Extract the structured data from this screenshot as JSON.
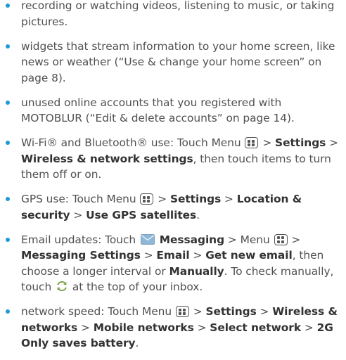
{
  "colors": {
    "bullet": "#1e9ad6",
    "text": "#505050",
    "bold": "#333333"
  },
  "items": [
    {
      "t": "recording or watching videos, listening to music, or taking pictures."
    },
    {
      "t": "widgets that stream information to your home screen, like news or weather (“Use & change your home screen” on page 8)."
    },
    {
      "t": "unused online accounts that you registered with MOTOBLUR (“Edit & delete accounts” on page 14)."
    },
    {
      "t1": "Wi-Fi® and Bluetooth® use: Touch Menu",
      "t2": ">",
      "b1": "Settings",
      "t3": ">",
      "b2": "Wireless & network settings",
      "t4": ", then touch items to turn them off or on."
    },
    {
      "t1": "GPS use: Touch Menu",
      "t2": ">",
      "b1": "Settings",
      "t3": ">",
      "b2": "Location & security",
      "t4": ">",
      "b3": "Use GPS satellites",
      "t5": "."
    },
    {
      "t1": "Email updates: Touch",
      "b1": "Messaging",
      "t2": "> Menu",
      "t3": ">",
      "b2": "Messaging Settings",
      "t4": ">",
      "b3": "Email",
      "t5": ">",
      "b4": "Get new email",
      "t6": ", then choose a longer interval or",
      "b5": "Manually",
      "t7": ". To check manually, touch",
      "t8": "at the top of your inbox."
    },
    {
      "t1": "network speed: Touch Menu",
      "t2": ">",
      "b1": "Settings",
      "t3": ">",
      "b2": "Wireless & networks",
      "t4": ">",
      "b3": "Mobile networks",
      "t5": ">",
      "b4": "Select network",
      "t6": ">",
      "b5": "2G Only saves battery",
      "t7": "."
    }
  ]
}
